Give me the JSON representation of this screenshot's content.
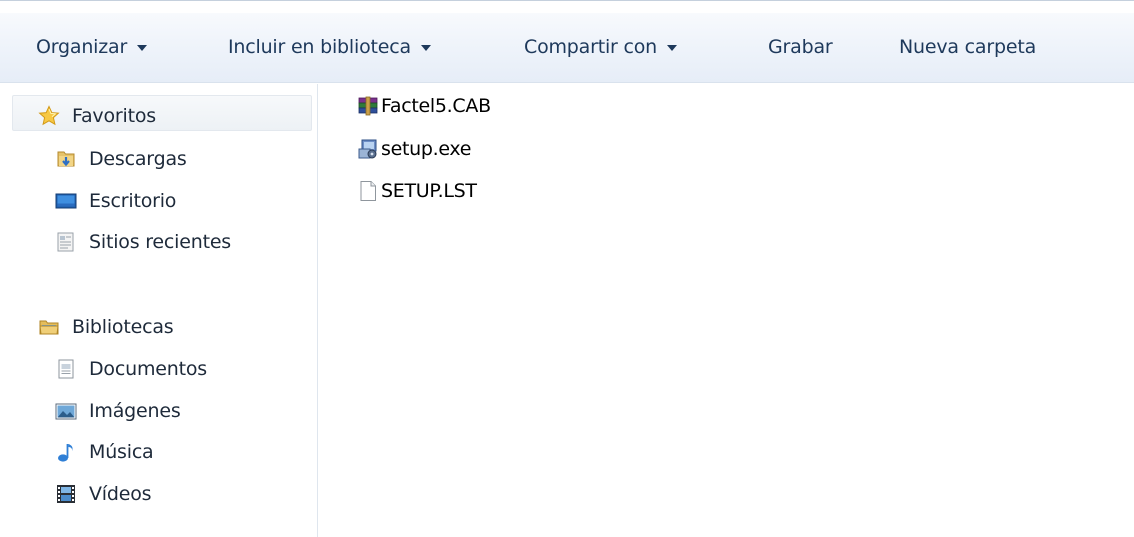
{
  "toolbar": {
    "organize_label": "Organizar",
    "include_library_label": "Incluir en biblioteca",
    "share_label": "Compartir con",
    "burn_label": "Grabar",
    "new_folder_label": "Nueva carpeta"
  },
  "nav": {
    "favorites": {
      "label": "Favoritos",
      "icon": "star-icon",
      "items": [
        {
          "label": "Descargas",
          "icon": "downloads-folder-icon"
        },
        {
          "label": "Escritorio",
          "icon": "desktop-icon"
        },
        {
          "label": "Sitios recientes",
          "icon": "recent-places-icon"
        }
      ]
    },
    "libraries": {
      "label": "Bibliotecas",
      "icon": "libraries-folder-icon",
      "items": [
        {
          "label": "Documentos",
          "icon": "documents-icon"
        },
        {
          "label": "Imágenes",
          "icon": "pictures-icon"
        },
        {
          "label": "Música",
          "icon": "music-icon"
        },
        {
          "label": "Vídeos",
          "icon": "videos-icon"
        }
      ]
    }
  },
  "files": [
    {
      "name": "Factel5.CAB",
      "icon": "winrar-archive-icon"
    },
    {
      "name": "setup.exe",
      "icon": "setup-exe-icon"
    },
    {
      "name": "SETUP.LST",
      "icon": "blank-file-icon"
    }
  ]
}
